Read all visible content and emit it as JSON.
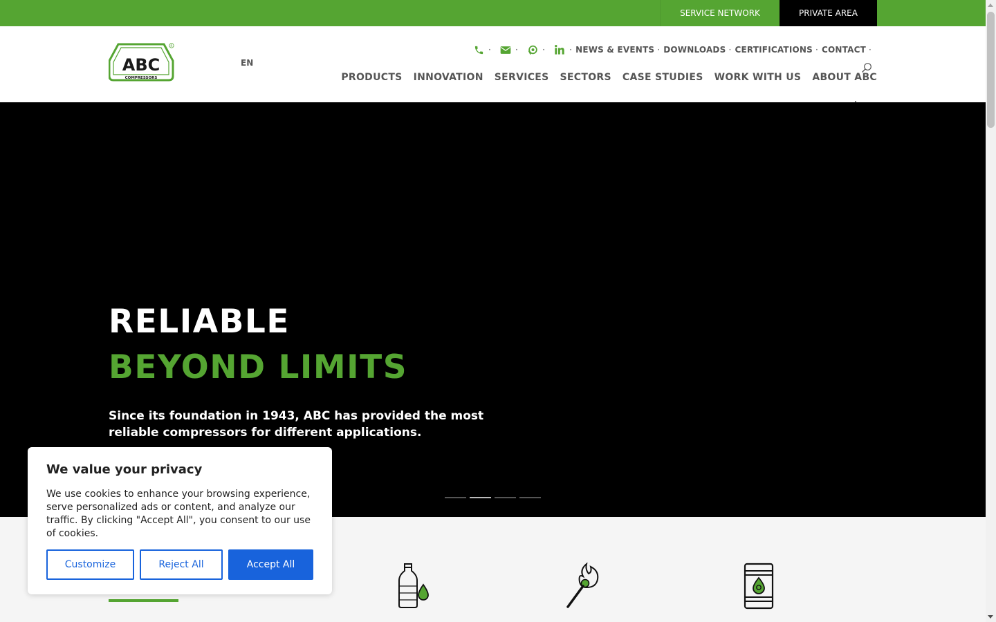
{
  "topbar": {
    "service_network": "SERVICE NETWORK",
    "private_area": "PRIVATE AREA"
  },
  "header": {
    "brand": "ABC",
    "brand_sub": "COMPRESSORS",
    "lang": "EN",
    "utility_links": [
      "NEWS & EVENTS",
      "DOWNLOADS",
      "CERTIFICATIONS",
      "CONTACT"
    ],
    "main_nav": [
      "PRODUCTS",
      "INNOVATION",
      "SERVICES",
      "SECTORS",
      "CASE STUDIES",
      "WORK WITH US",
      "ABOUT ABC"
    ]
  },
  "hero": {
    "title_line1": "RELIABLE",
    "title_line2": "BEYOND LIMITS",
    "subtitle": "Since its foundation in 1943, ABC has provided the most reliable compressors for different applications.",
    "slides_count": 4,
    "active_slide": 2
  },
  "sectors": {
    "icons": [
      "bottle-drop-icon",
      "match-flame-icon",
      "oil-barrel-icon"
    ]
  },
  "cookie": {
    "title": "We value your privacy",
    "text": "We use cookies to enhance your browsing experience, serve personalized ads or content, and analyze our traffic. By clicking \"Accept All\", you consent to our use of cookies.",
    "customize": "Customize",
    "reject": "Reject All",
    "accept": "Accept All"
  },
  "colors": {
    "brand_green": "#55a532",
    "cookie_blue": "#1863dc",
    "text_gray": "#555555"
  }
}
